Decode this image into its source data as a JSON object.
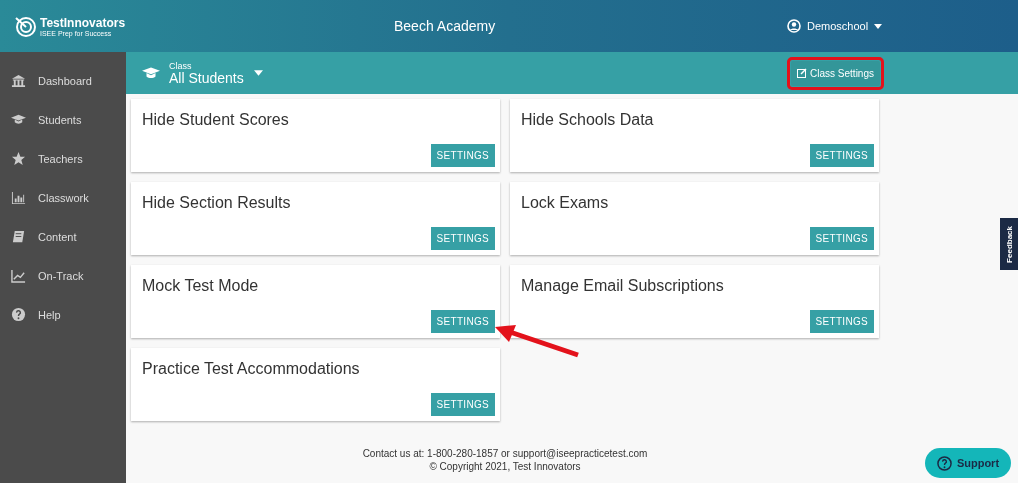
{
  "header": {
    "logo_name": "TestInnovators",
    "logo_tagline": "ISEE Prep for Success",
    "title": "Beech Academy",
    "user": "Demoschool"
  },
  "sidebar": {
    "items": [
      {
        "label": "Dashboard",
        "kind": "bank"
      },
      {
        "label": "Students",
        "kind": "cap"
      },
      {
        "label": "Teachers",
        "kind": "star"
      },
      {
        "label": "Classwork",
        "kind": "bars"
      },
      {
        "label": "Content",
        "kind": "book"
      },
      {
        "label": "On-Track",
        "kind": "line"
      },
      {
        "label": "Help",
        "kind": "help"
      }
    ]
  },
  "class_bar": {
    "label": "Class",
    "value": "All Students",
    "button": "Class Settings",
    "button_highlighted": true
  },
  "cards": [
    {
      "title": "Hide Student Scores",
      "button": "SETTINGS"
    },
    {
      "title": "Hide Schools Data",
      "button": "SETTINGS"
    },
    {
      "title": "Hide Section Results",
      "button": "SETTINGS"
    },
    {
      "title": "Lock Exams",
      "button": "SETTINGS"
    },
    {
      "title": "Mock Test Mode",
      "button": "SETTINGS",
      "pointed": true
    },
    {
      "title": "Manage Email Subscriptions",
      "button": "SETTINGS"
    },
    {
      "title": "Practice Test Accommodations",
      "button": "SETTINGS"
    }
  ],
  "footer": {
    "contact": "Contact us at: 1-800-280-1857 or support@iseepracticetest.com",
    "copyright": "© Copyright 2021, Test Innovators"
  },
  "feedback_tab": "Feedback",
  "support_button": "Support"
}
